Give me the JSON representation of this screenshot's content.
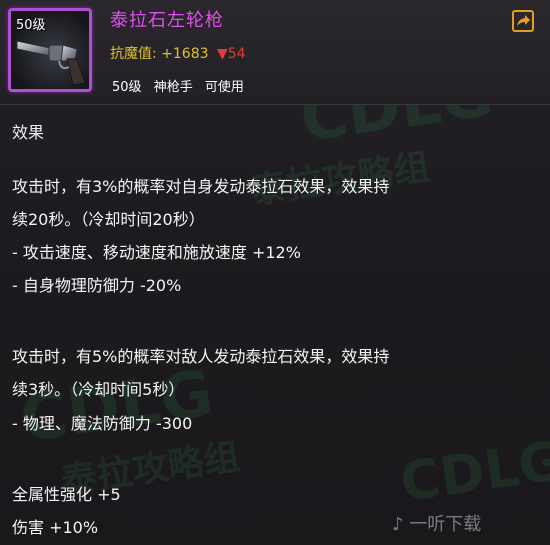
{
  "item": {
    "level_badge": "50级",
    "name": "泰拉石左轮枪",
    "stat_label": "抗魔值:",
    "stat_value": "+1683",
    "stat_diff": "▼54",
    "req_level": "50级",
    "req_class": "神枪手",
    "req_usable": "可使用",
    "icon": "revolver-icon"
  },
  "effect": {
    "title": "效果",
    "lines": [
      "攻击时，有3%的概率对自身发动泰拉石效果，效果持",
      "续20秒。（冷却时间20秒）",
      "- 攻击速度、移动速度和施放速度 +12%",
      "- 自身物理防御力 -20%",
      "攻击时，有5%的概率对敌人发动泰拉石效果，效果持",
      "续3秒。（冷却时间5秒）",
      "- 物理、魔法防御力 -300",
      "全属性强化 +5",
      "伤害 +10%"
    ]
  },
  "watermark": {
    "latin": "CDLG",
    "chinese": "泰拉攻略组"
  },
  "brand": "一听下载",
  "colors": {
    "item_name": "#e04ff0",
    "stat": "#e0c030",
    "decrease": "#e03c3c",
    "frame": "#b04fd0"
  }
}
